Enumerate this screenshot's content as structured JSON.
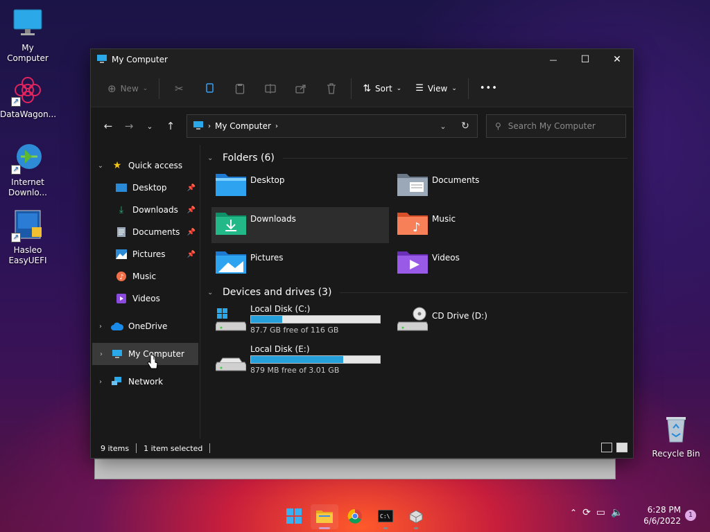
{
  "desktop": {
    "icons": [
      {
        "label": "My Computer"
      },
      {
        "label": "DataWagon..."
      },
      {
        "label": "Internet Downlo..."
      },
      {
        "label": "Hasleo EasyUEFI"
      },
      {
        "label": "Recycle Bin"
      }
    ]
  },
  "window": {
    "title": "My Computer",
    "controls": {
      "minimize": "—",
      "maximize": "☐",
      "close": "✕"
    }
  },
  "toolbar": {
    "new_label": "New",
    "sort_label": "Sort",
    "view_label": "View",
    "more_label": "•••"
  },
  "address": {
    "crumb": "My Computer",
    "search_placeholder": "Search My Computer"
  },
  "sidebar": {
    "quick_access": "Quick access",
    "items": [
      {
        "label": "Desktop",
        "pinned": true
      },
      {
        "label": "Downloads",
        "pinned": true
      },
      {
        "label": "Documents",
        "pinned": true
      },
      {
        "label": "Pictures",
        "pinned": true
      },
      {
        "label": "Music",
        "pinned": false
      },
      {
        "label": "Videos",
        "pinned": false
      }
    ],
    "onedrive": "OneDrive",
    "my_computer": "My Computer",
    "network": "Network"
  },
  "folders": {
    "header": "Folders (6)",
    "items": [
      {
        "name": "Desktop"
      },
      {
        "name": "Documents"
      },
      {
        "name": "Downloads"
      },
      {
        "name": "Music"
      },
      {
        "name": "Pictures"
      },
      {
        "name": "Videos"
      }
    ]
  },
  "drives": {
    "header": "Devices and drives (3)",
    "items": [
      {
        "name": "Local Disk (C:)",
        "free": "87.7 GB free of 116 GB",
        "used_fraction": 0.244
      },
      {
        "name": "CD Drive (D:)"
      },
      {
        "name": "Local Disk (E:)",
        "free": "879 MB free of 3.01 GB",
        "used_fraction": 0.715
      }
    ]
  },
  "status": {
    "items": "9 items",
    "selected": "1 item selected"
  },
  "taskbar": {
    "time": "6:28 PM",
    "date": "6/6/2022",
    "notifications": "1"
  },
  "colors": {
    "accent": "#26a0da",
    "window_bg": "#191919",
    "selected_bg": "#3a3a3a"
  }
}
